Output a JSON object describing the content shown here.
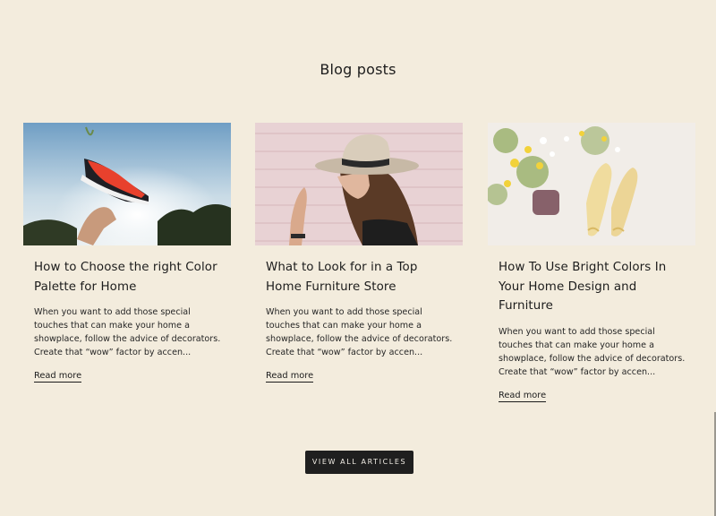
{
  "section": {
    "title": "Blog posts"
  },
  "posts": [
    {
      "title": "How to Choose the right Color Palette for Home",
      "excerpt": "When you want to add those special touches that can make your home a showplace, follow the advice of decorators. Create that “wow” factor by accen...",
      "read_more": "Read more",
      "image_icon": "sneaker-photo"
    },
    {
      "title": "What to Look for in a Top Home Furniture Store",
      "excerpt": "When you want to add those special touches that can make your home a showplace, follow the advice of decorators. Create that “wow” factor by accen...",
      "read_more": "Read more",
      "image_icon": "woman-hat-photo"
    },
    {
      "title": "How To Use Bright Colors In Your Home Design and Furniture",
      "excerpt": "When you want to add those special touches that can make your home a showplace, follow the advice of decorators. Create that “wow” factor by accen...",
      "read_more": "Read more",
      "image_icon": "shoes-flowers-photo"
    }
  ],
  "footer": {
    "view_all_label": "VIEW ALL ARTICLES"
  },
  "colors": {
    "background": "#f3ecdd",
    "button": "#1f1f1f",
    "text": "#1c1c1c"
  }
}
